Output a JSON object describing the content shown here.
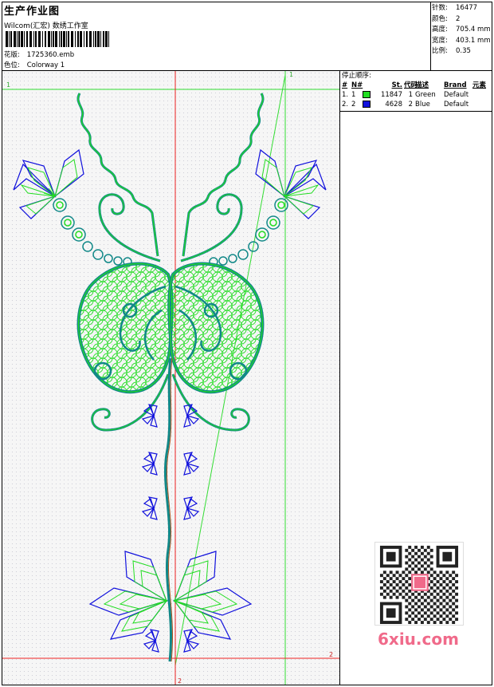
{
  "header": {
    "title": "生产作业图",
    "company": "Wilcom(汇宏) 数绣工作室",
    "design_label": "花版:",
    "design_file": "1725360.emb",
    "colorway_label": "色位:",
    "colorway": "Colorway 1"
  },
  "stats": [
    {
      "label": "针数:",
      "value": "16477"
    },
    {
      "label": "颜色:",
      "value": "2"
    },
    {
      "label": "高度:",
      "value": "705.4 mm"
    },
    {
      "label": "宽度:",
      "value": "403.1 mm"
    },
    {
      "label": "比例:",
      "value": "0.35"
    }
  ],
  "stop_sequence": {
    "title": "停止顺序:",
    "columns": {
      "num": "#",
      "n": "N#",
      "st": "St.",
      "code": "代码",
      "desc": "描述",
      "brand": "Brand",
      "element": "元素"
    },
    "rows": [
      {
        "num": "1.",
        "n": "1",
        "swatch": "#22dd22",
        "st": "11847",
        "code": "1",
        "desc": "Green",
        "brand": "Default"
      },
      {
        "num": "2.",
        "n": "2",
        "swatch": "#1111dd",
        "st": "4628",
        "code": "2",
        "desc": "Blue",
        "brand": "Default"
      }
    ]
  },
  "guides": {
    "h_top_label": "1",
    "v_right_label": "1",
    "h_bottom_label": "2",
    "v_center_label": "2"
  },
  "colors": {
    "green": "#22dd22",
    "blue": "#1111dd",
    "guide_red": "#ee2222",
    "guide_green": "#33dd33"
  },
  "logo": {
    "text": "6xiu.com"
  }
}
